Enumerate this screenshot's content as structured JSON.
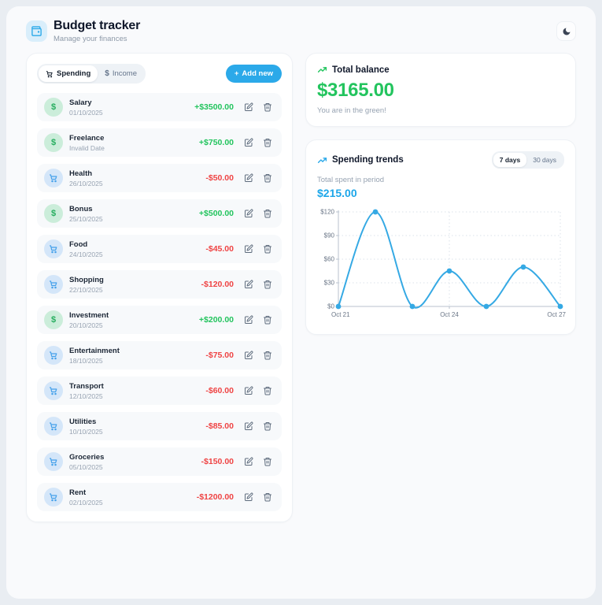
{
  "header": {
    "title": "Budget tracker",
    "subtitle": "Manage your finances"
  },
  "theme_toggle": {
    "icon": "moon-icon"
  },
  "tabs": [
    {
      "label": "Spending",
      "icon": "cart-icon",
      "active": true
    },
    {
      "label": "Income",
      "icon": "dollar-icon",
      "active": false
    }
  ],
  "add_button": {
    "label": "Add new",
    "icon": "plus-icon"
  },
  "transactions": [
    {
      "name": "Salary",
      "date": "01/10/2025",
      "amount": "+$3500.00",
      "type": "income"
    },
    {
      "name": "Freelance",
      "date": "Invalid Date",
      "amount": "+$750.00",
      "type": "income"
    },
    {
      "name": "Health",
      "date": "26/10/2025",
      "amount": "-$50.00",
      "type": "expense"
    },
    {
      "name": "Bonus",
      "date": "25/10/2025",
      "amount": "+$500.00",
      "type": "income"
    },
    {
      "name": "Food",
      "date": "24/10/2025",
      "amount": "-$45.00",
      "type": "expense"
    },
    {
      "name": "Shopping",
      "date": "22/10/2025",
      "amount": "-$120.00",
      "type": "expense"
    },
    {
      "name": "Investment",
      "date": "20/10/2025",
      "amount": "+$200.00",
      "type": "income"
    },
    {
      "name": "Entertainment",
      "date": "18/10/2025",
      "amount": "-$75.00",
      "type": "expense"
    },
    {
      "name": "Transport",
      "date": "12/10/2025",
      "amount": "-$60.00",
      "type": "expense"
    },
    {
      "name": "Utilities",
      "date": "10/10/2025",
      "amount": "-$85.00",
      "type": "expense"
    },
    {
      "name": "Groceries",
      "date": "05/10/2025",
      "amount": "-$150.00",
      "type": "expense"
    },
    {
      "name": "Rent",
      "date": "02/10/2025",
      "amount": "-$1200.00",
      "type": "expense"
    }
  ],
  "balance": {
    "title": "Total balance",
    "value": "$3165.00",
    "note": "You are in the green!"
  },
  "trends": {
    "title": "Spending trends",
    "period_options": [
      "7 days",
      "30 days"
    ],
    "active_period": "7 days",
    "total_label": "Total spent in period",
    "total_value": "$215.00"
  },
  "chart_data": {
    "type": "line",
    "x": [
      "Oct 21",
      "Oct 22",
      "Oct 23",
      "Oct 24",
      "Oct 25",
      "Oct 26",
      "Oct 27"
    ],
    "values": [
      0,
      120,
      0,
      45,
      0,
      50,
      0
    ],
    "y_ticks": [
      "$0",
      "$30",
      "$60",
      "$90",
      "$120"
    ],
    "y_tick_values": [
      0,
      30,
      60,
      90,
      120
    ],
    "x_tick_labels": [
      "Oct 21",
      "Oct 24",
      "Oct 27"
    ],
    "ylim": [
      0,
      120
    ],
    "grid": "dotted",
    "legend": "none",
    "smooth": true
  },
  "colors": {
    "positive": "#23c45e",
    "negative": "#ef4444",
    "accent_blue": "#2ba9e9",
    "chart_line": "#35a9e4",
    "total_spent_blue": "#1ca6e9"
  }
}
